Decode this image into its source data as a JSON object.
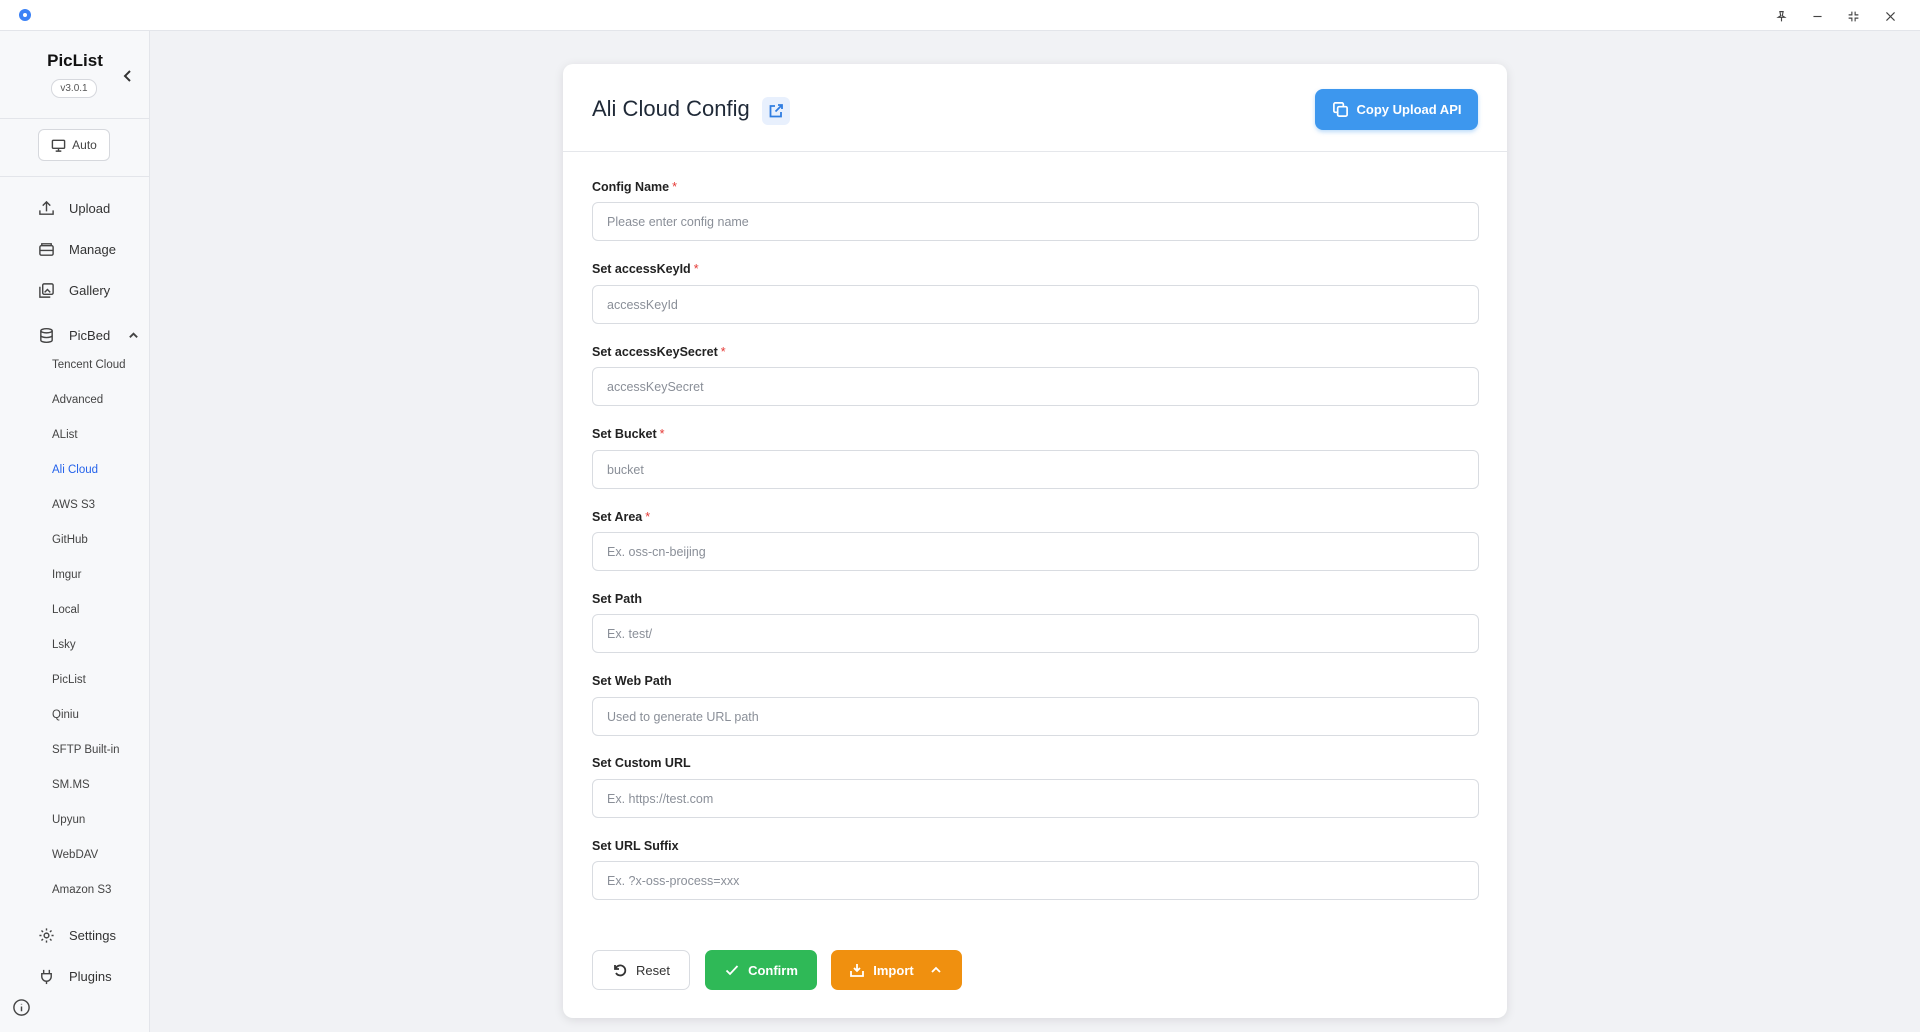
{
  "window": {
    "icons": [
      "pin-icon",
      "minimize-icon",
      "restore-icon",
      "close-icon"
    ]
  },
  "sidebar": {
    "app_name": "PicList",
    "version": "v3.0.1",
    "theme_label": "Auto",
    "nav": {
      "upload": "Upload",
      "manage": "Manage",
      "gallery": "Gallery",
      "picbed": "PicBed",
      "settings": "Settings",
      "plugins": "Plugins"
    },
    "picbed_items": [
      "Tencent Cloud",
      "Advanced",
      "AList",
      "Ali Cloud",
      "AWS S3",
      "GitHub",
      "Imgur",
      "Local",
      "Lsky",
      "PicList",
      "Qiniu",
      "SFTP Built-in",
      "SM.MS",
      "Upyun",
      "WebDAV",
      "Amazon S3"
    ],
    "active_picbed": "Ali Cloud"
  },
  "config": {
    "title": "Ali Cloud Config",
    "copy_api_label": "Copy Upload API",
    "fields": [
      {
        "label": "Config Name",
        "required": "*",
        "placeholder": "Please enter config name",
        "value": ""
      },
      {
        "label": "Set accessKeyId",
        "required": "*",
        "placeholder": "accessKeyId",
        "value": ""
      },
      {
        "label": "Set accessKeySecret",
        "required": "*",
        "placeholder": "accessKeySecret",
        "value": ""
      },
      {
        "label": "Set Bucket",
        "required": "*",
        "placeholder": "bucket",
        "value": ""
      },
      {
        "label": "Set Area",
        "required": "*",
        "placeholder": "Ex. oss-cn-beijing",
        "value": ""
      },
      {
        "label": "Set Path",
        "required": "",
        "placeholder": "Ex. test/",
        "value": ""
      },
      {
        "label": "Set Web Path",
        "required": "",
        "placeholder": "Used to generate URL path",
        "value": ""
      },
      {
        "label": "Set Custom URL",
        "required": "",
        "placeholder": "Ex. https://test.com",
        "value": ""
      },
      {
        "label": "Set URL Suffix",
        "required": "",
        "placeholder": "Ex. ?x-oss-process=xxx",
        "value": ""
      }
    ],
    "buttons": {
      "reset": "Reset",
      "confirm": "Confirm",
      "import": "Import"
    }
  },
  "colors": {
    "primary": "#3d97ee",
    "confirm": "#2fb957",
    "import": "#f0900f",
    "required": "#e53935"
  }
}
